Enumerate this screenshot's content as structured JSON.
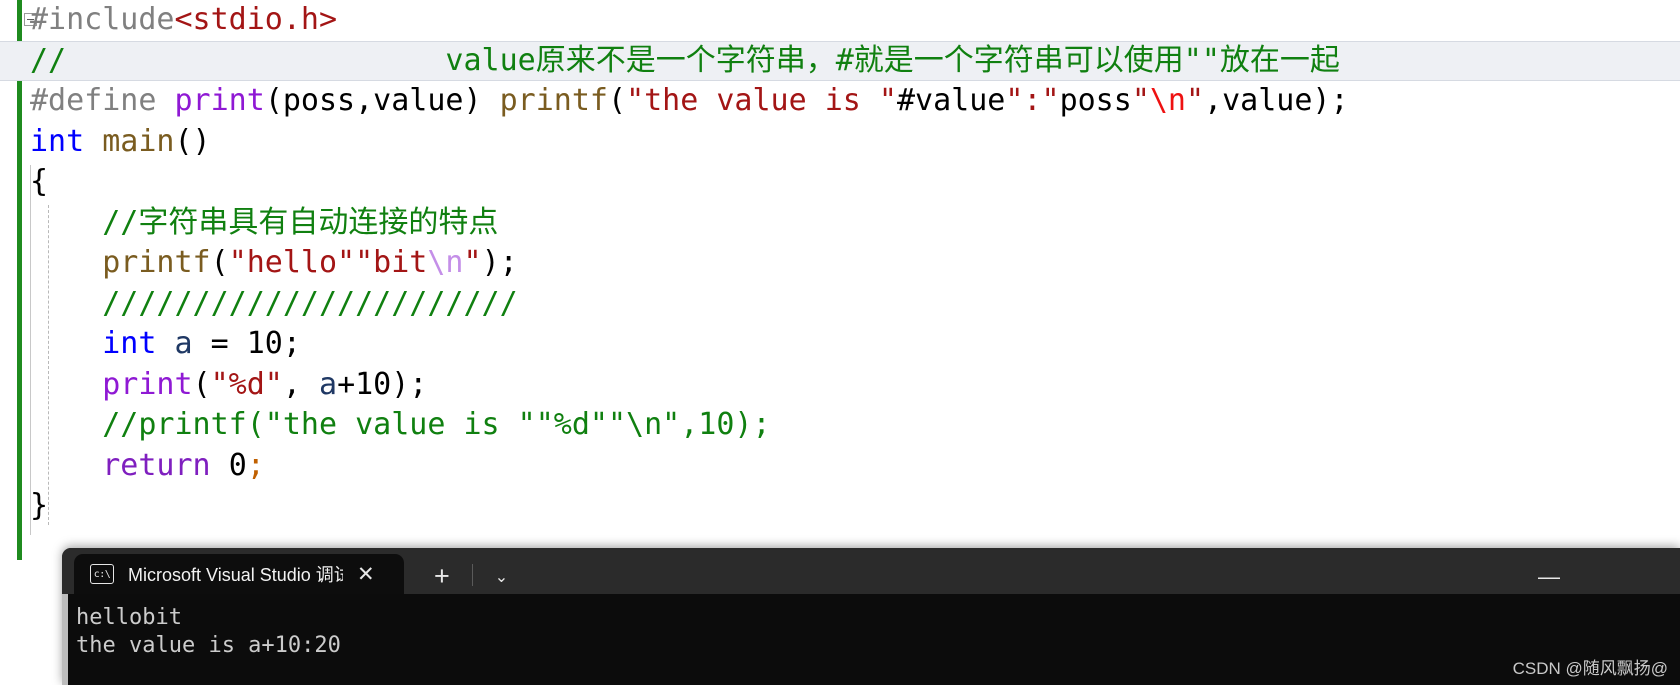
{
  "editor": {
    "change_bar_color": "#1f8b1f",
    "lines": [
      {
        "id": "line-include",
        "highlighted": false,
        "tokens": [
          {
            "t": "#include",
            "c": "k-macro"
          },
          {
            "t": "<stdio.h>",
            "c": "k-str"
          }
        ]
      },
      {
        "id": "line-comment-value",
        "highlighted": true,
        "tokens": [
          {
            "t": "//                     value原来不是一个字符串，#就是一个字符串可以使用\"\"放在一起",
            "c": "k-comment"
          }
        ]
      },
      {
        "id": "line-define-print",
        "highlighted": false,
        "tokens": [
          {
            "t": "#define ",
            "c": "k-macro"
          },
          {
            "t": "print",
            "c": "k-macroname"
          },
          {
            "t": "(poss,value) ",
            "c": "k-punc"
          },
          {
            "t": "printf",
            "c": "k-fn"
          },
          {
            "t": "(",
            "c": "k-punc"
          },
          {
            "t": "\"the value is \"",
            "c": "k-str"
          },
          {
            "t": "#value",
            "c": "k-punc"
          },
          {
            "t": "\":\"",
            "c": "k-str"
          },
          {
            "t": "poss",
            "c": "k-punc"
          },
          {
            "t": "\"",
            "c": "k-str"
          },
          {
            "t": "\\n",
            "c": "k-esc-red"
          },
          {
            "t": "\"",
            "c": "k-str"
          },
          {
            "t": ",value);",
            "c": "k-punc"
          }
        ]
      },
      {
        "id": "line-main",
        "highlighted": false,
        "tokens": [
          {
            "t": "int ",
            "c": "k-blue"
          },
          {
            "t": "main",
            "c": "k-fn"
          },
          {
            "t": "()",
            "c": "k-punc"
          }
        ]
      },
      {
        "id": "line-open-brace",
        "highlighted": false,
        "tokens": [
          {
            "t": "{",
            "c": "k-punc"
          }
        ]
      },
      {
        "id": "line-comment-concat",
        "highlighted": false,
        "tokens": [
          {
            "t": "    //字符串具有自动连接的特点",
            "c": "k-comment"
          }
        ]
      },
      {
        "id": "line-printf-hellobit",
        "highlighted": false,
        "tokens": [
          {
            "t": "    ",
            "c": "k-punc"
          },
          {
            "t": "printf",
            "c": "k-fn"
          },
          {
            "t": "(",
            "c": "k-punc"
          },
          {
            "t": "\"hello\"\"bit",
            "c": "k-str"
          },
          {
            "t": "\\n",
            "c": "k-esc-vio"
          },
          {
            "t": "\"",
            "c": "k-str"
          },
          {
            "t": ");",
            "c": "k-punc"
          }
        ]
      },
      {
        "id": "line-comment-slashes",
        "highlighted": false,
        "tokens": [
          {
            "t": "    ///////////////////////",
            "c": "k-comment"
          }
        ]
      },
      {
        "id": "line-int-a",
        "highlighted": false,
        "tokens": [
          {
            "t": "    ",
            "c": "k-punc"
          },
          {
            "t": "int ",
            "c": "k-blue"
          },
          {
            "t": "a",
            "c": "k-var"
          },
          {
            "t": " = ",
            "c": "k-punc"
          },
          {
            "t": "10;",
            "c": "k-num"
          }
        ]
      },
      {
        "id": "line-print-call",
        "highlighted": false,
        "tokens": [
          {
            "t": "    ",
            "c": "k-punc"
          },
          {
            "t": "print",
            "c": "k-macroname"
          },
          {
            "t": "(",
            "c": "k-punc"
          },
          {
            "t": "\"%d\"",
            "c": "k-str"
          },
          {
            "t": ", ",
            "c": "k-punc"
          },
          {
            "t": "a",
            "c": "k-var"
          },
          {
            "t": "+10);",
            "c": "k-punc"
          }
        ]
      },
      {
        "id": "line-comment-printf",
        "highlighted": false,
        "tokens": [
          {
            "t": "    //printf(\"the value is \"\"%d\"\"\\n\",10);",
            "c": "k-comment"
          }
        ]
      },
      {
        "id": "line-return",
        "highlighted": false,
        "tokens": [
          {
            "t": "    ",
            "c": "k-punc"
          },
          {
            "t": "return ",
            "c": "k-purple"
          },
          {
            "t": "0",
            "c": "k-num"
          },
          {
            "t": ";",
            "c": "k-semi"
          }
        ]
      },
      {
        "id": "line-close-brace",
        "highlighted": false,
        "tokens": [
          {
            "t": "}",
            "c": "k-punc"
          }
        ]
      }
    ]
  },
  "terminal": {
    "tab": {
      "icon_text": "c:\\",
      "title": "Microsoft Visual Studio 调试控",
      "close_label": "✕"
    },
    "new_tab_label": "+",
    "dropdown_label": "⌄",
    "minimize_label": "—",
    "output_lines": [
      "hellobit",
      "the value is a+10:20"
    ]
  },
  "watermark": {
    "text": "CSDN @随风飘扬@"
  }
}
